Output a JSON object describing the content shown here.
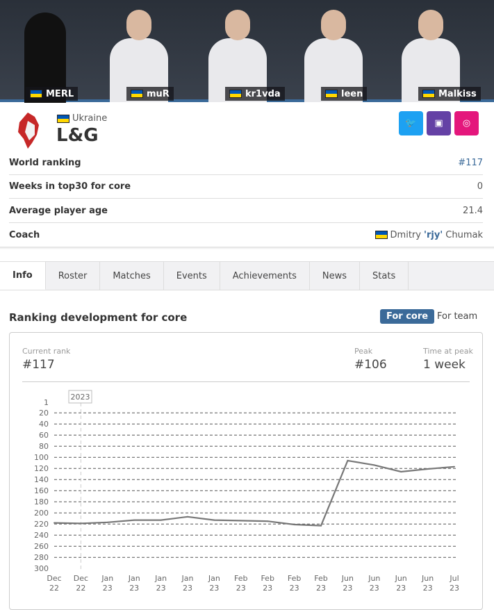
{
  "players": [
    {
      "name": "MERL"
    },
    {
      "name": "muR"
    },
    {
      "name": "kr1vda"
    },
    {
      "name": "leen"
    },
    {
      "name": "Malkiss"
    }
  ],
  "team": {
    "country": "Ukraine",
    "name": "L&G"
  },
  "social": {
    "twitter": "twitter-icon",
    "twitch": "twitch-icon",
    "instagram": "instagram-icon",
    "colors": {
      "twitter": "#1da1f2",
      "twitch": "#6441a5",
      "instagram": "#e4167c"
    }
  },
  "stats": [
    {
      "label": "World ranking",
      "value": "#117"
    },
    {
      "label": "Weeks in top30 for core",
      "value": "0"
    },
    {
      "label": "Average player age",
      "value": "21.4"
    }
  ],
  "coach": {
    "label": "Coach",
    "first": "Dmitry",
    "nick": "'rjy'",
    "last": "Chumak"
  },
  "tabs": [
    "Info",
    "Roster",
    "Matches",
    "Events",
    "Achievements",
    "News",
    "Stats"
  ],
  "ranking": {
    "title": "Ranking development for core",
    "toggle_core": "For core",
    "toggle_team": "For team",
    "current_label": "Current rank",
    "current": "#117",
    "peak_label": "Peak",
    "peak": "#106",
    "time_label": "Time at peak",
    "time": "1 week"
  },
  "chart_data": {
    "type": "line",
    "year_marker": "2023",
    "ylim": [
      1,
      300
    ],
    "y_inverted": true,
    "yticks": [
      1,
      20,
      40,
      60,
      80,
      100,
      120,
      140,
      160,
      180,
      200,
      220,
      240,
      260,
      280,
      300
    ],
    "categories": [
      [
        "Dec",
        "22"
      ],
      [
        "Dec",
        "22"
      ],
      [
        "Jan",
        "23"
      ],
      [
        "Jan",
        "23"
      ],
      [
        "Jan",
        "23"
      ],
      [
        "Jan",
        "23"
      ],
      [
        "Jan",
        "23"
      ],
      [
        "Feb",
        "23"
      ],
      [
        "Feb",
        "23"
      ],
      [
        "Feb",
        "23"
      ],
      [
        "Feb",
        "23"
      ],
      [
        "Jun",
        "23"
      ],
      [
        "Jun",
        "23"
      ],
      [
        "Jun",
        "23"
      ],
      [
        "Jun",
        "23"
      ],
      [
        "Jul",
        "23"
      ]
    ],
    "values": [
      218,
      219,
      217,
      213,
      213,
      207,
      213,
      214,
      215,
      221,
      223,
      106,
      114,
      126,
      121,
      117
    ],
    "grid": true,
    "line_color": "#777777"
  }
}
